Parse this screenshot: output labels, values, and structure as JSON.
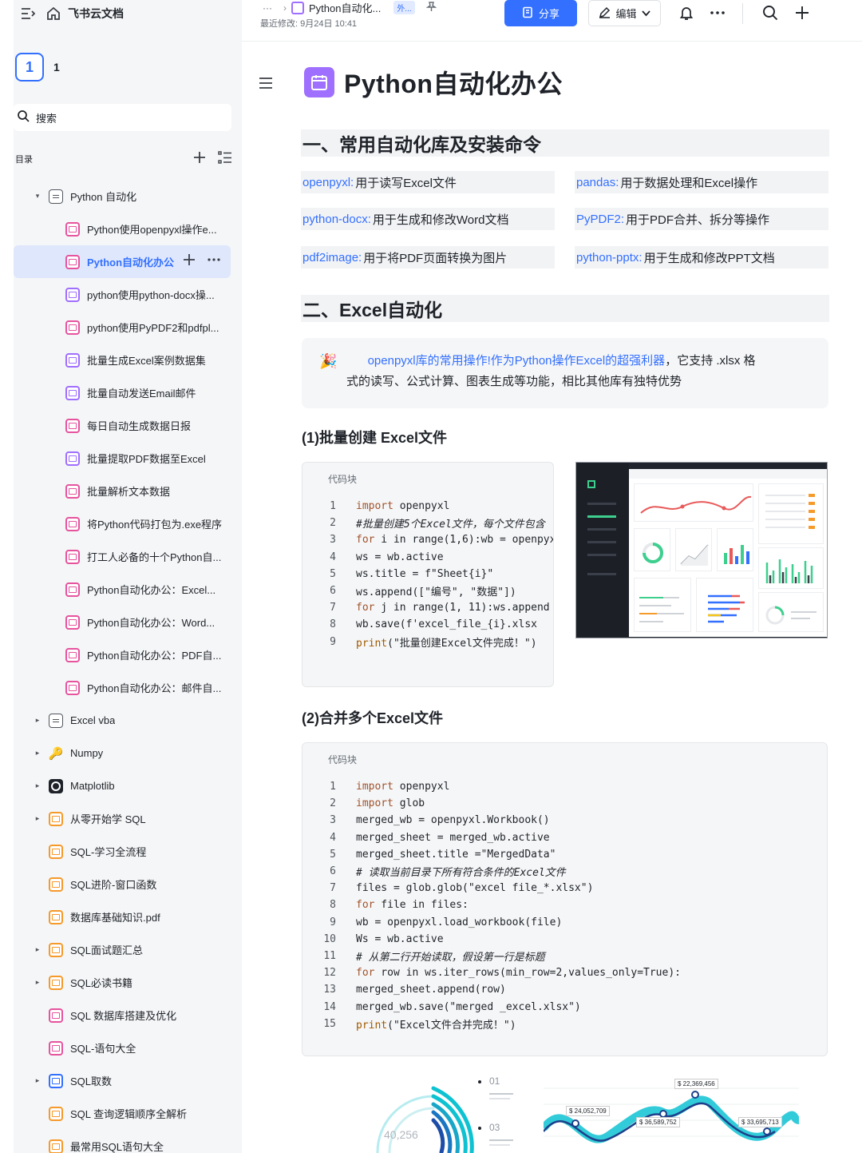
{
  "app": {
    "brand": "飞书云文档",
    "workspace_badge": "1",
    "workspace_name": "1"
  },
  "sidebar": {
    "search_label": "搜索",
    "toc_label": "目录",
    "items": [
      {
        "label": "Python 自动化",
        "level": 0,
        "arrow": "▾",
        "icon": "doc"
      },
      {
        "label": "Python使用openpyxl操作e...",
        "level": 1,
        "icon": "pink"
      },
      {
        "label": "Python自动化办公",
        "level": 1,
        "icon": "pink",
        "active": true
      },
      {
        "label": "python使用python-docx操...",
        "level": 1,
        "icon": "purple"
      },
      {
        "label": "python使用PyPDF2和pdfpl...",
        "level": 1,
        "icon": "pink"
      },
      {
        "label": "批量生成Excel案例数据集",
        "level": 1,
        "icon": "purple"
      },
      {
        "label": "批量自动发送Email邮件",
        "level": 1,
        "icon": "purple"
      },
      {
        "label": "每日自动生成数据日报",
        "level": 1,
        "icon": "pink"
      },
      {
        "label": "批量提取PDF数据至Excel",
        "level": 1,
        "icon": "purple"
      },
      {
        "label": "批量解析文本数据",
        "level": 1,
        "icon": "pink"
      },
      {
        "label": "将Python代码打包为.exe程序",
        "level": 1,
        "icon": "pink"
      },
      {
        "label": "打工人必备的十个Python自...",
        "level": 1,
        "icon": "pink"
      },
      {
        "label": "Python自动化办公：Excel...",
        "level": 1,
        "icon": "pink"
      },
      {
        "label": "Python自动化办公：Word...",
        "level": 1,
        "icon": "pink"
      },
      {
        "label": "Python自动化办公：PDF自...",
        "level": 1,
        "icon": "pink"
      },
      {
        "label": "Python自动化办公：邮件自...",
        "level": 1,
        "icon": "pink"
      },
      {
        "label": "Excel vba",
        "level": 0,
        "arrow": "▸",
        "icon": "doc"
      },
      {
        "label": "Numpy",
        "level": 0,
        "arrow": "▸",
        "icon": "key"
      },
      {
        "label": "Matplotlib",
        "level": 0,
        "arrow": "▸",
        "icon": "dark"
      },
      {
        "label": "从零开始学 SQL",
        "level": 0,
        "arrow": "▸",
        "icon": "orange"
      },
      {
        "label": "SQL-学习全流程",
        "level": 0,
        "icon": "orange"
      },
      {
        "label": "SQL进阶-窗口函数",
        "level": 0,
        "icon": "orange"
      },
      {
        "label": "数据库基础知识.pdf",
        "level": 0,
        "icon": "orange"
      },
      {
        "label": "SQL面试题汇总",
        "level": 0,
        "arrow": "▸",
        "icon": "orange"
      },
      {
        "label": "SQL必读书籍",
        "level": 0,
        "arrow": "▸",
        "icon": "orange"
      },
      {
        "label": "SQL 数据库搭建及优化",
        "level": 0,
        "icon": "pink"
      },
      {
        "label": "SQL-语句大全",
        "level": 0,
        "icon": "pink"
      },
      {
        "label": "SQL取数",
        "level": 0,
        "arrow": "▸",
        "icon": "blue"
      },
      {
        "label": "SQL 查询逻辑顺序全解析",
        "level": 0,
        "icon": "orange"
      },
      {
        "label": "最常用SQL语句大全",
        "level": 0,
        "icon": "orange"
      }
    ]
  },
  "header": {
    "breadcrumb_more": "···",
    "breadcrumb_sep": "›",
    "doc_title_short": "Python自动化...",
    "ext_tag": "外...",
    "last_edit": "最近修改: 9月24日 10:41",
    "share_label": "分享",
    "edit_label": "编辑"
  },
  "doc": {
    "title": "Python自动化办公",
    "section1": "一、常用自动化库及安装命令",
    "libs": [
      {
        "name": "openpyxl:",
        "desc": "用于读写Excel文件"
      },
      {
        "name": "pandas:",
        "desc": "用于数据处理和Excel操作"
      },
      {
        "name": "python-docx:",
        "desc": "用于生成和修改Word文档"
      },
      {
        "name": "PyPDF2:",
        "desc": "用于PDF合并、拆分等操作"
      },
      {
        "name": "pdf2image:",
        "desc": "用于将PDF页面转换为图片"
      },
      {
        "name": "python-pptx:",
        "desc": "用于生成和修改PPT文档"
      }
    ],
    "section2": "二、Excel自动化",
    "callout_emoji": "🎉",
    "callout_highlight": "openpyxl库的常用操作!作为Python操作Excel的超强利器",
    "callout_rest1": "，它支持 .xlsx 格",
    "callout_rest2": "式的读写、公式计算、图表生成等功能，相比其他库有独特优势",
    "sub1": "(1)批量创建 Excel文件",
    "sub2": "(2)合并多个Excel文件",
    "code_caption": "代码块",
    "code1": [
      "import openpyxl",
      "#批量创建5个Excel文件，每个文件包含",
      "for i in range(1,6):wb = openpyxl",
      "ws = wb.active",
      "ws.title = f\"Sheet{i}\"",
      "ws.append([\"编号\", \"数据\"])",
      "for j in range(1, 11):ws.append",
      "wb.save(f'excel_file_{i}.xlsx",
      "print(\"批量创建Excel文件完成！\")"
    ],
    "code2": [
      "import openpyxl",
      "import glob",
      "merged_wb = openpyxl.Workbook()",
      "merged_sheet = merged_wb.active",
      "merged_sheet.title =\"MergedData\"",
      "# 读取当前目录下所有符合条件的Excel文件",
      "files = glob.glob(\"excel file_*.xlsx\")",
      "for file in files:",
      "wb = openpyxl.load_workbook(file)",
      "Ws = wb.active",
      "# 从第二行开始读取，假设第一行是标题",
      "for row in ws.iter_rows(min_row=2,values_only=True):",
      "merged_sheet.append(row)",
      "merged_wb.save(\"merged _excel.xlsx\")",
      "print(\"Excel文件合并完成！\")"
    ],
    "bottom_art": {
      "big_number": "40,256",
      "list_markers": [
        "01",
        "03"
      ],
      "value_labels": [
        "$ 22,369,456",
        "$ 24,052,709",
        "$ 36,589,752",
        "$ 33,695,713"
      ]
    }
  },
  "colors": {
    "accent": "#3370ff",
    "doc_icon": "#9f6fff",
    "sidebar_bg": "#f5f6f7",
    "active_bg": "#dfe7fd"
  }
}
